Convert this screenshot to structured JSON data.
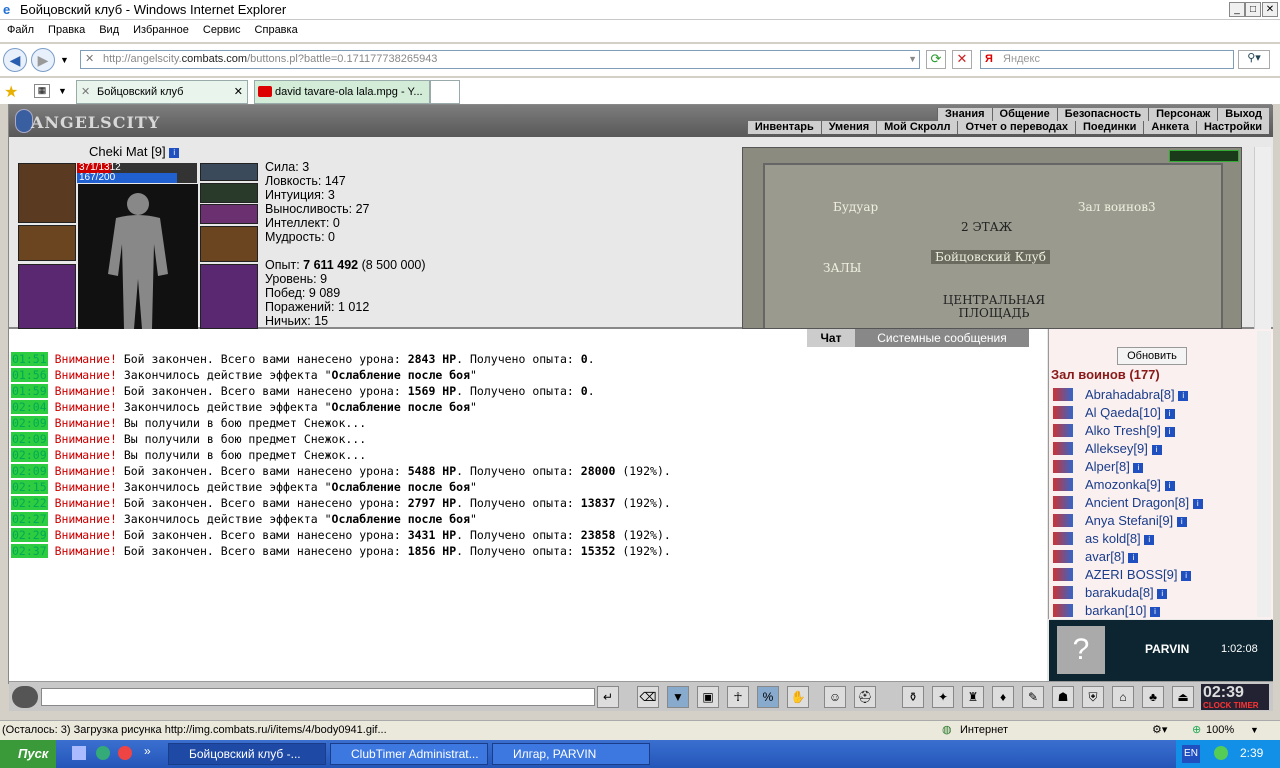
{
  "window": {
    "title": "Бойцовский клуб - Windows Internet Explorer"
  },
  "menu": [
    "Файл",
    "Правка",
    "Вид",
    "Избранное",
    "Сервис",
    "Справка"
  ],
  "address": {
    "prefix": "http://angelscity.",
    "host": "combats.com",
    "path": "/buttons.pl?battle=0.171177738265943"
  },
  "search": {
    "placeholder": "Яндекс"
  },
  "tabs": [
    {
      "label": "Бойцовский клуб"
    },
    {
      "label": "david tavare-ola lala.mpg - Y..."
    }
  ],
  "game": {
    "logo": "ANGELSCITY",
    "menu_top": [
      "Знания",
      "Общение",
      "Безопасность",
      "Персонаж",
      "Выход"
    ],
    "menu_bottom": [
      "Инвентарь",
      "Умения",
      "Мой Скролл",
      "Отчет о переводах",
      "Поединки",
      "Анкета",
      "Настройки"
    ],
    "character": {
      "name": "Cheki Mat",
      "level": "[9]",
      "hp": "371/1312",
      "mana": "167/200",
      "hp_fraction": 0.283,
      "mana_fraction": 0.835
    },
    "stats": [
      {
        "label": "Сила:",
        "value": "3"
      },
      {
        "label": "Ловкость:",
        "value": "147"
      },
      {
        "label": "Интуиция:",
        "value": "3"
      },
      {
        "label": "Выносливость:",
        "value": "27"
      },
      {
        "label": "Интеллект:",
        "value": "0"
      },
      {
        "label": "Мудрость:",
        "value": "0"
      }
    ],
    "stats2": [
      {
        "label": "Опыт:",
        "value": "7 611 492",
        "extra": "(8 500 000)"
      },
      {
        "label": "Уровень:",
        "value": "9",
        "extra": ""
      },
      {
        "label": "Побед:",
        "value": "9 089",
        "extra": ""
      },
      {
        "label": "Поражений:",
        "value": "1 012",
        "extra": ""
      },
      {
        "label": "Ничьих:",
        "value": "15",
        "extra": ""
      }
    ],
    "map": {
      "left": "Будуар",
      "right": "Зал воинов3",
      "floor": "2 ЭТАЖ",
      "club": "Бойцовский Клуб",
      "halls": "ЗАЛЫ",
      "square": "ЦЕНТРАЛЬНАЯ ПЛОЩАДЬ"
    },
    "chat_tabs": [
      "Чат",
      "Системные сообщения"
    ],
    "messages": [
      {
        "time": "01:51",
        "warn": "Внимание!",
        "text": "Бой закончен. Всего вами нанесено урона: ",
        "b1": "2843 HP",
        "text2": ". Получено опыта: ",
        "b2": "0",
        "text3": "."
      },
      {
        "time": "01:56",
        "warn": "Внимание!",
        "text": "Закончилось действие эффекта \"",
        "b1": "Ослабление после боя",
        "text2": "\"",
        "b2": "",
        "text3": ""
      },
      {
        "time": "01:59",
        "warn": "Внимание!",
        "text": "Бой закончен. Всего вами нанесено урона: ",
        "b1": "1569 HP",
        "text2": ". Получено опыта: ",
        "b2": "0",
        "text3": "."
      },
      {
        "time": "02:04",
        "warn": "Внимание!",
        "text": "Закончилось действие эффекта \"",
        "b1": "Ослабление после боя",
        "text2": "\"",
        "b2": "",
        "text3": ""
      },
      {
        "time": "02:09",
        "warn": "Внимание!",
        "text": "Вы получили в бою предмет Снежок...",
        "b1": "",
        "text2": "",
        "b2": "",
        "text3": ""
      },
      {
        "time": "02:09",
        "warn": "Внимание!",
        "text": "Вы получили в бою предмет Снежок...",
        "b1": "",
        "text2": "",
        "b2": "",
        "text3": ""
      },
      {
        "time": "02:09",
        "warn": "Внимание!",
        "text": "Вы получили в бою предмет Снежок...",
        "b1": "",
        "text2": "",
        "b2": "",
        "text3": ""
      },
      {
        "time": "02:09",
        "warn": "Внимание!",
        "text": "Бой закончен. Всего вами нанесено урона: ",
        "b1": "5488 HP",
        "text2": ". Получено опыта: ",
        "b2": "28000",
        "text3": " (192%)."
      },
      {
        "time": "02:15",
        "warn": "Внимание!",
        "text": "Закончилось действие эффекта \"",
        "b1": "Ослабление после боя",
        "text2": "\"",
        "b2": "",
        "text3": ""
      },
      {
        "time": "02:22",
        "warn": "Внимание!",
        "text": "Бой закончен. Всего вами нанесено урона: ",
        "b1": "2797 HP",
        "text2": ". Получено опыта: ",
        "b2": "13837",
        "text3": " (192%)."
      },
      {
        "time": "02:27",
        "warn": "Внимание!",
        "text": "Закончилось действие эффекта \"",
        "b1": "Ослабление после боя",
        "text2": "\"",
        "b2": "",
        "text3": ""
      },
      {
        "time": "02:29",
        "warn": "Внимание!",
        "text": "Бой закончен. Всего вами нанесено урона: ",
        "b1": "3431 HP",
        "text2": ". Получено опыта: ",
        "b2": "23858",
        "text3": " (192%)."
      },
      {
        "time": "02:37",
        "warn": "Внимание!",
        "text": "Бой закончен. Всего вами нанесено урона: ",
        "b1": "1856 HP",
        "text2": ". Получено опыта: ",
        "b2": "15352",
        "text3": " (192%)."
      }
    ],
    "refresh_label": "Обновить",
    "room": "Зал воинов (177)",
    "users": [
      {
        "name": "Abrahadabra",
        "level": "[8]"
      },
      {
        "name": "Al Qaeda",
        "level": "[10]"
      },
      {
        "name": "Alko Tresh",
        "level": "[9]"
      },
      {
        "name": "Alleksey",
        "level": "[9]"
      },
      {
        "name": "Alper",
        "level": "[8]"
      },
      {
        "name": "Amozonka",
        "level": "[9]"
      },
      {
        "name": "Ancient Dragon",
        "level": "[8]"
      },
      {
        "name": "Anya Stefani",
        "level": "[9]"
      },
      {
        "name": "as kold",
        "level": "[8]"
      },
      {
        "name": "avar",
        "level": "[8]"
      },
      {
        "name": "AZERI BOSS",
        "level": "[9]"
      },
      {
        "name": "barakuda",
        "level": "[8]"
      },
      {
        "name": "barkan",
        "level": "[10]"
      }
    ],
    "popup": {
      "name": "PARVIN",
      "time": "1:02:08"
    },
    "clock": {
      "time": "02:39",
      "label": "CLOCK TIMER"
    }
  },
  "status": {
    "text": "(Осталось: 3) Загрузка рисунка http://img.combats.ru/i/items/4/body0941.gif...",
    "zone": "Интернет",
    "zoom": "100%"
  },
  "taskbar": {
    "start": "Пуск",
    "items": [
      "Бойцовский клуб -...",
      "ClubTimer Administrat...",
      "Илгар, PARVIN"
    ],
    "lang": "EN",
    "time": "2:39"
  }
}
